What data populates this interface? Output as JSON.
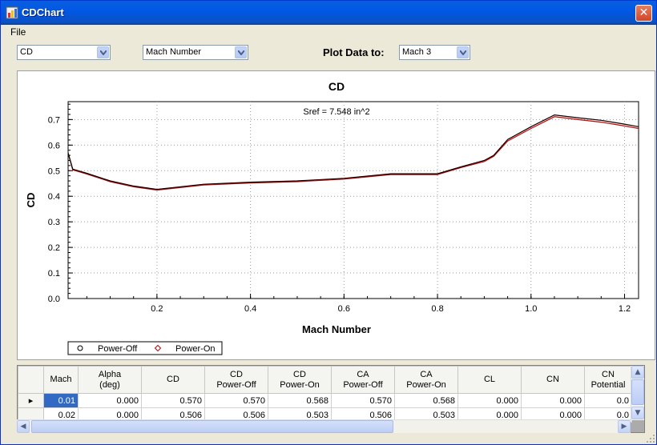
{
  "window": {
    "title": "CDChart",
    "close_glyph": "✕"
  },
  "menu": {
    "items": [
      "File"
    ]
  },
  "toolbar": {
    "y_select": "CD",
    "x_select": "Mach Number",
    "plot_label": "Plot Data to:",
    "plot_select": "Mach 3"
  },
  "chart_data": {
    "type": "line",
    "title": "CD",
    "annotation": "Sref = 7.548 in^2",
    "xlabel": "Mach Number",
    "ylabel": "CD",
    "xlim": [
      0.01,
      1.23
    ],
    "ylim": [
      0.0,
      0.77
    ],
    "xticks": [
      "0.2",
      "0.4",
      "0.6",
      "0.8",
      "1.0",
      "1.2"
    ],
    "yticks": [
      "0.0",
      "0.1",
      "0.2",
      "0.3",
      "0.4",
      "0.5",
      "0.6",
      "0.7"
    ],
    "grid": true,
    "legend_position": "bottom-left",
    "series": [
      {
        "name": "Power-Off",
        "color": "#000000",
        "x": [
          0.01,
          0.02,
          0.05,
          0.1,
          0.15,
          0.2,
          0.3,
          0.4,
          0.5,
          0.6,
          0.7,
          0.8,
          0.85,
          0.9,
          0.92,
          0.95,
          1.0,
          1.05,
          1.1,
          1.15,
          1.2,
          1.23
        ],
        "y": [
          0.57,
          0.506,
          0.49,
          0.46,
          0.44,
          0.427,
          0.447,
          0.455,
          0.46,
          0.47,
          0.488,
          0.488,
          0.515,
          0.54,
          0.56,
          0.622,
          0.672,
          0.718,
          0.707,
          0.697,
          0.682,
          0.672
        ]
      },
      {
        "name": "Power-On",
        "color": "#cc0000",
        "x": [
          0.01,
          0.02,
          0.05,
          0.1,
          0.15,
          0.2,
          0.3,
          0.4,
          0.5,
          0.6,
          0.7,
          0.8,
          0.85,
          0.9,
          0.92,
          0.95,
          1.0,
          1.05,
          1.1,
          1.15,
          1.2,
          1.23
        ],
        "y": [
          0.568,
          0.503,
          0.487,
          0.457,
          0.437,
          0.424,
          0.444,
          0.452,
          0.457,
          0.467,
          0.485,
          0.485,
          0.512,
          0.536,
          0.556,
          0.616,
          0.665,
          0.711,
          0.7,
          0.69,
          0.675,
          0.665
        ]
      }
    ]
  },
  "grid": {
    "columns": [
      [
        "Mach",
        ""
      ],
      [
        "Alpha",
        "(deg)"
      ],
      [
        "CD",
        ""
      ],
      [
        "CD",
        "Power-Off"
      ],
      [
        "CD",
        "Power-On"
      ],
      [
        "CA",
        "Power-Off"
      ],
      [
        "CA",
        "Power-On"
      ],
      [
        "CL",
        ""
      ],
      [
        "CN",
        ""
      ],
      [
        "CN",
        "Potential"
      ]
    ],
    "rows": [
      [
        "0.01",
        "0.000",
        "0.570",
        "0.570",
        "0.568",
        "0.570",
        "0.568",
        "0.000",
        "0.000",
        "0.0"
      ],
      [
        "0.02",
        "0.000",
        "0.506",
        "0.506",
        "0.503",
        "0.506",
        "0.503",
        "0.000",
        "0.000",
        "0.0"
      ]
    ],
    "current_row_marker": "▸"
  },
  "colors": {
    "titlebar": "#0058e6",
    "selection": "#316ac5",
    "power_off": "#000000",
    "power_on": "#cc0000"
  }
}
